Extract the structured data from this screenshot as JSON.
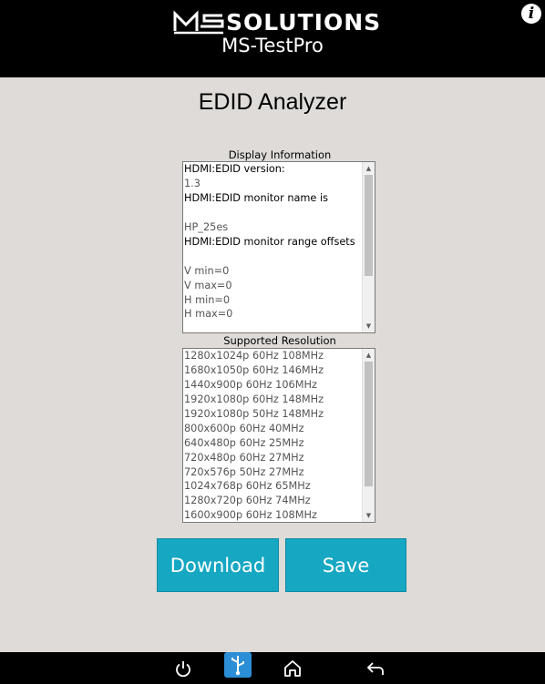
{
  "header": {
    "logo_text": "SOLUTIONS",
    "app_title": "MS-TestPro",
    "info_icon": "info-icon"
  },
  "page": {
    "title": "EDID Analyzer"
  },
  "display_info": {
    "label": "Display Information",
    "lines": [
      "HDMI:EDID version:",
      "1.3",
      "HDMI:EDID monitor name is",
      "",
      "HP_25es",
      "HDMI:EDID monitor range offsets",
      "",
      "V min=0",
      "V max=0",
      "H min=0",
      "H max=0"
    ]
  },
  "resolutions": {
    "label": "Supported Resolution",
    "items": [
      "1280x1024p 60Hz 108MHz",
      "1680x1050p 60Hz 146MHz",
      "1440x900p 60Hz 106MHz",
      "1920x1080p 60Hz 148MHz",
      "1920x1080p 50Hz 148MHz",
      "800x600p 60Hz 40MHz",
      "640x480p 60Hz 25MHz",
      "720x480p 60Hz 27MHz",
      "720x576p 50Hz 27MHz",
      "1024x768p 60Hz 65MHz",
      "1280x720p 60Hz 74MHz",
      "1600x900p 60Hz 108MHz"
    ]
  },
  "buttons": {
    "download": "Download",
    "save": "Save"
  },
  "navbar": {
    "icons": [
      "power-icon",
      "usb-icon",
      "home-icon",
      "back-icon"
    ]
  },
  "colors": {
    "header_bg": "#000000",
    "page_bg": "#dedbd8",
    "button": "#16a7c3"
  }
}
